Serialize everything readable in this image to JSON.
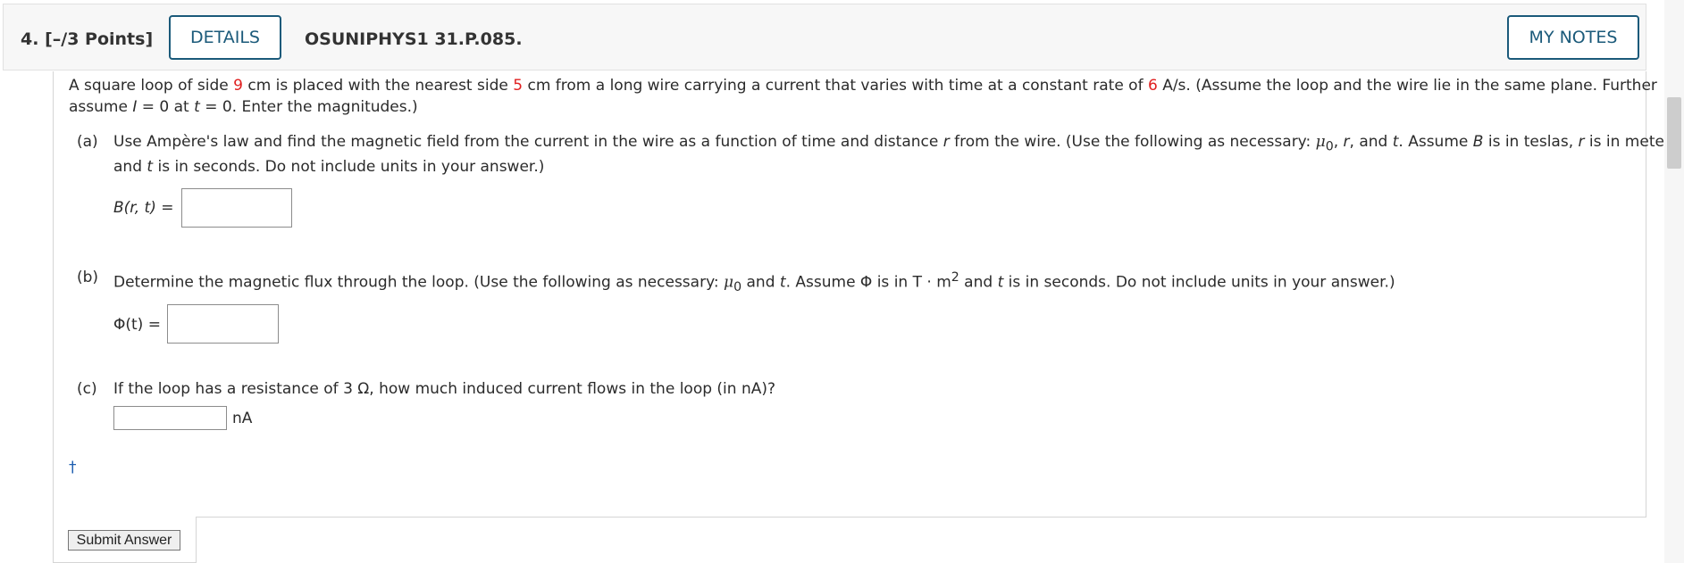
{
  "header": {
    "question_number": "4.",
    "points": "[–/3 Points]",
    "details_label": "DETAILS",
    "question_code": "OSUNIPHYS1 31.P.085.",
    "notes_label": "MY NOTES"
  },
  "problem": {
    "intro_1": "A square loop of side ",
    "side": "9",
    "intro_2": " cm is placed with the nearest side ",
    "distance": "5",
    "intro_3": " cm from a long wire carrying a current that varies with time at a constant rate of ",
    "rate": "6",
    "intro_4": " A/s. (Assume the loop and the wire lie in the same plane. Further",
    "intro_line2_a": "assume ",
    "intro_I": "I",
    "intro_line2_b": " = 0 at ",
    "intro_t": "t",
    "intro_line2_c": " = 0. Enter the magnitudes.)"
  },
  "part_a": {
    "tag": "(a)",
    "line1_a": "Use Ampère's law and find the magnetic field from the current in the wire as a function of time and distance ",
    "r": "r",
    "line1_b": " from the wire. (Use the following as necessary: ",
    "mu": "μ",
    "sub0": "0",
    "line1_c": ", ",
    "line1_d": ", and ",
    "t": "t",
    "line1_e": ". Assume ",
    "B": "B",
    "line1_f": " is in teslas, ",
    "line1_g": " is in meters",
    "line2_a": "and ",
    "line2_b": " is in seconds. Do not include units in your answer.)",
    "answer_label": "B(r, t) ="
  },
  "part_b": {
    "tag": "(b)",
    "text_a": "Determine the magnetic flux through the loop. (Use the following as necessary: ",
    "mu": "μ",
    "sub0": "0",
    "text_b": " and ",
    "t": "t",
    "text_c": ". Assume Φ is in T · m",
    "sup2": "2",
    "text_d": " and ",
    "text_e": " is in seconds. Do not include units in your answer.)",
    "answer_label": "Φ(t) ="
  },
  "part_c": {
    "tag": "(c)",
    "text": "If the loop has a resistance of 3 Ω, how much induced current flows in the loop (in nA)?",
    "unit": "nA"
  },
  "dagger": "†",
  "submit_label": "Submit Answer"
}
